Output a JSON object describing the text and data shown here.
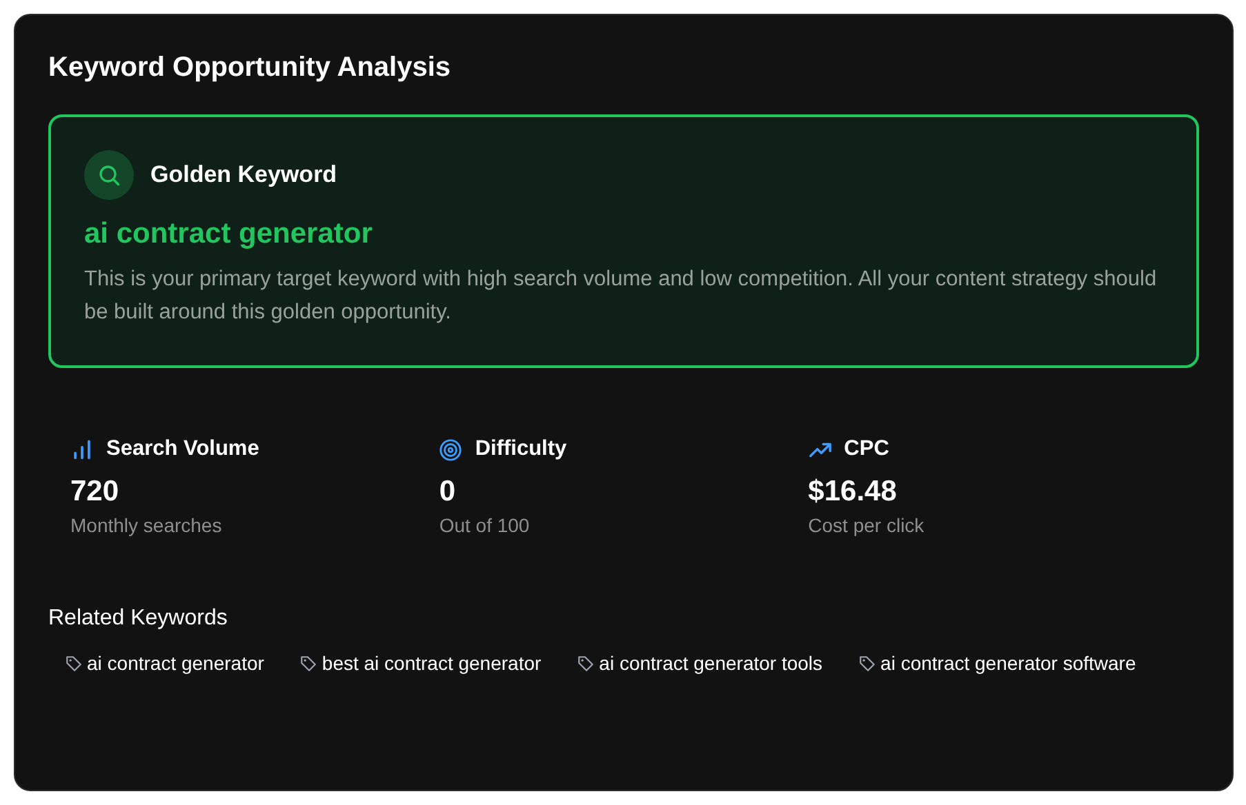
{
  "title": "Keyword Opportunity Analysis",
  "golden": {
    "label": "Golden Keyword",
    "keyword": "ai contract generator",
    "description": "This is your primary target keyword with high search volume and low competition. All your content strategy should be built around this golden opportunity."
  },
  "metrics": [
    {
      "kind": "volume",
      "label": "Search Volume",
      "value": "720",
      "caption": "Monthly searches"
    },
    {
      "kind": "difficulty",
      "label": "Difficulty",
      "value": "0",
      "caption": "Out of 100"
    },
    {
      "kind": "cpc",
      "label": "CPC",
      "value": "$16.48",
      "caption": "Cost per click"
    }
  ],
  "related": {
    "title": "Related Keywords",
    "keywords": [
      "ai contract generator",
      "best ai contract generator",
      "ai contract generator tools",
      "ai contract generator software"
    ]
  }
}
